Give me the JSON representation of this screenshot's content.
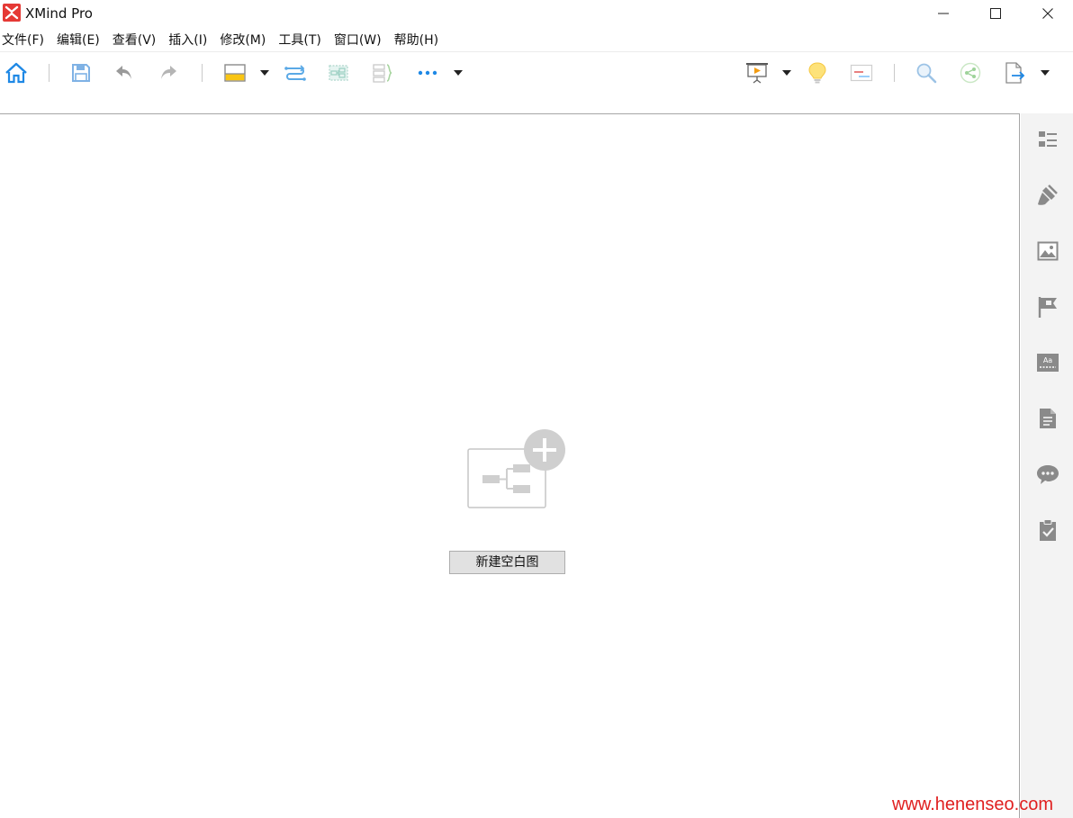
{
  "window": {
    "title": "XMind Pro",
    "icon": "xmind-logo-icon",
    "controls": [
      "minimize-icon",
      "maximize-icon",
      "close-icon"
    ]
  },
  "menu": {
    "items": [
      {
        "label": "文件(F)"
      },
      {
        "label": "编辑(E)"
      },
      {
        "label": "查看(V)"
      },
      {
        "label": "插入(I)"
      },
      {
        "label": "修改(M)"
      },
      {
        "label": "工具(T)"
      },
      {
        "label": "窗口(W)"
      },
      {
        "label": "帮助(H)"
      }
    ]
  },
  "toolbar": {
    "left_icons": [
      "home-icon",
      "save-icon",
      "undo-icon",
      "redo-icon",
      "topic-icon",
      "relationship-icon",
      "boundary-icon",
      "summary-icon",
      "more-icon"
    ],
    "right_icons": [
      "presentation-icon",
      "brainstorm-icon",
      "gantt-icon",
      "search-icon",
      "share-icon",
      "export-icon"
    ]
  },
  "canvas": {
    "new_blank_label": "新建空白图"
  },
  "sidepanel": {
    "icons": [
      "outline-icon",
      "format-brush-icon",
      "image-icon",
      "marker-flag-icon",
      "text-style-icon",
      "notes-icon",
      "comments-icon",
      "task-icon"
    ]
  },
  "watermark": {
    "text": "www.henenseo.com"
  },
  "colors": {
    "accent_blue": "#1e88e5",
    "logo_red": "#e53935",
    "watermark_red": "#e02020",
    "panel_bg": "#f3f3f3"
  }
}
